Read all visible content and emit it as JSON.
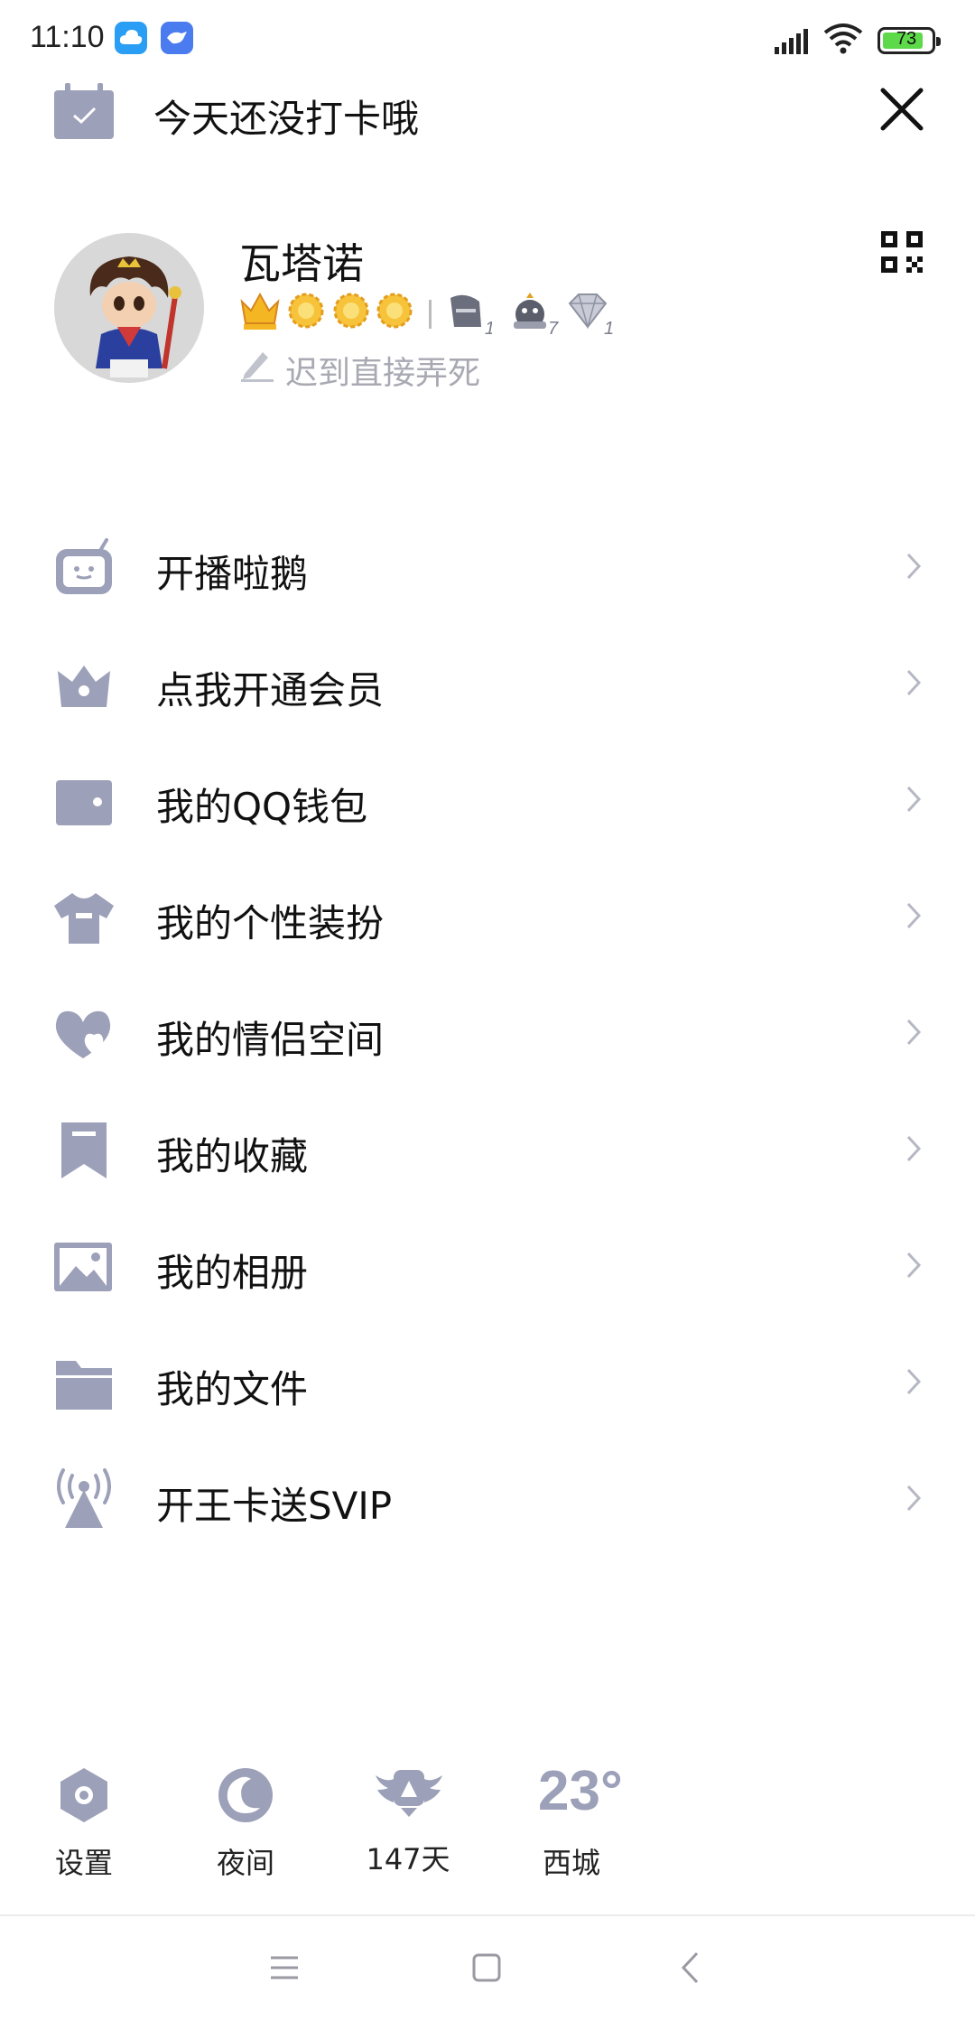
{
  "status_bar": {
    "time": "11:10",
    "battery": "73",
    "accent_battery": "#5dd94a"
  },
  "checkin": {
    "text": "今天还没打卡哦",
    "icon": "calendar-check-icon"
  },
  "profile": {
    "username": "瓦塔诺",
    "signature": "迟到直接弄死",
    "badges": [
      "crown-icon",
      "sun-icon",
      "sun-icon",
      "sun-icon",
      "knight-badge-icon",
      "penguin-badge-icon",
      "diamond-badge-icon"
    ],
    "badge_numbers": [
      "1",
      "7",
      "1"
    ]
  },
  "menu": {
    "items": [
      {
        "label": "开播啦鹅",
        "icon": "tv-icon"
      },
      {
        "label": "点我开通会员",
        "icon": "crown-icon"
      },
      {
        "label": "我的QQ钱包",
        "icon": "wallet-icon"
      },
      {
        "label": "我的个性装扮",
        "icon": "shirt-icon"
      },
      {
        "label": "我的情侣空间",
        "icon": "hearts-icon"
      },
      {
        "label": "我的收藏",
        "icon": "bookmark-icon"
      },
      {
        "label": "我的相册",
        "icon": "image-icon"
      },
      {
        "label": "我的文件",
        "icon": "folder-icon"
      },
      {
        "label": "开王卡送SVIP",
        "icon": "antenna-icon"
      }
    ]
  },
  "bottom_bar": {
    "settings_label": "设置",
    "night_label": "夜间",
    "days_label": "147天",
    "temperature": "23°",
    "location": "西城"
  },
  "colors": {
    "icon_gray": "#9ca0b8",
    "text": "#111111",
    "signature": "#a9a9b3"
  }
}
